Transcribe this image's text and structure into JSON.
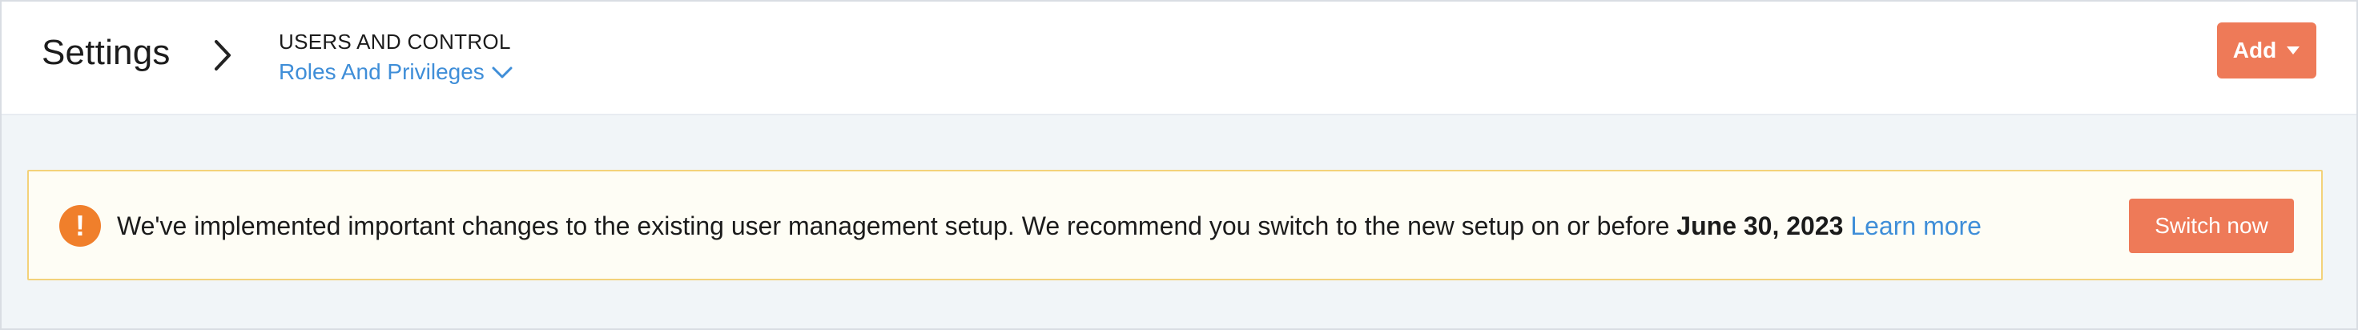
{
  "header": {
    "title": "Settings",
    "breadcrumb_section": "USERS AND CONTROL",
    "breadcrumb_page": "Roles And Privileges",
    "add_label": "Add"
  },
  "banner": {
    "icon": "exclamation-icon",
    "message": "We've implemented important changes to the existing user management setup. We recommend you switch to the new setup on or before",
    "date": "June 30, 2023",
    "link_label": "Learn more",
    "button_label": "Switch now"
  },
  "colors": {
    "accent": "#ee7a58",
    "link": "#3f8ed8",
    "warning": "#f07f2b",
    "banner_bg": "#fefdf5",
    "banner_border": "#f3d27a",
    "page_bg": "#f1f5f8"
  }
}
